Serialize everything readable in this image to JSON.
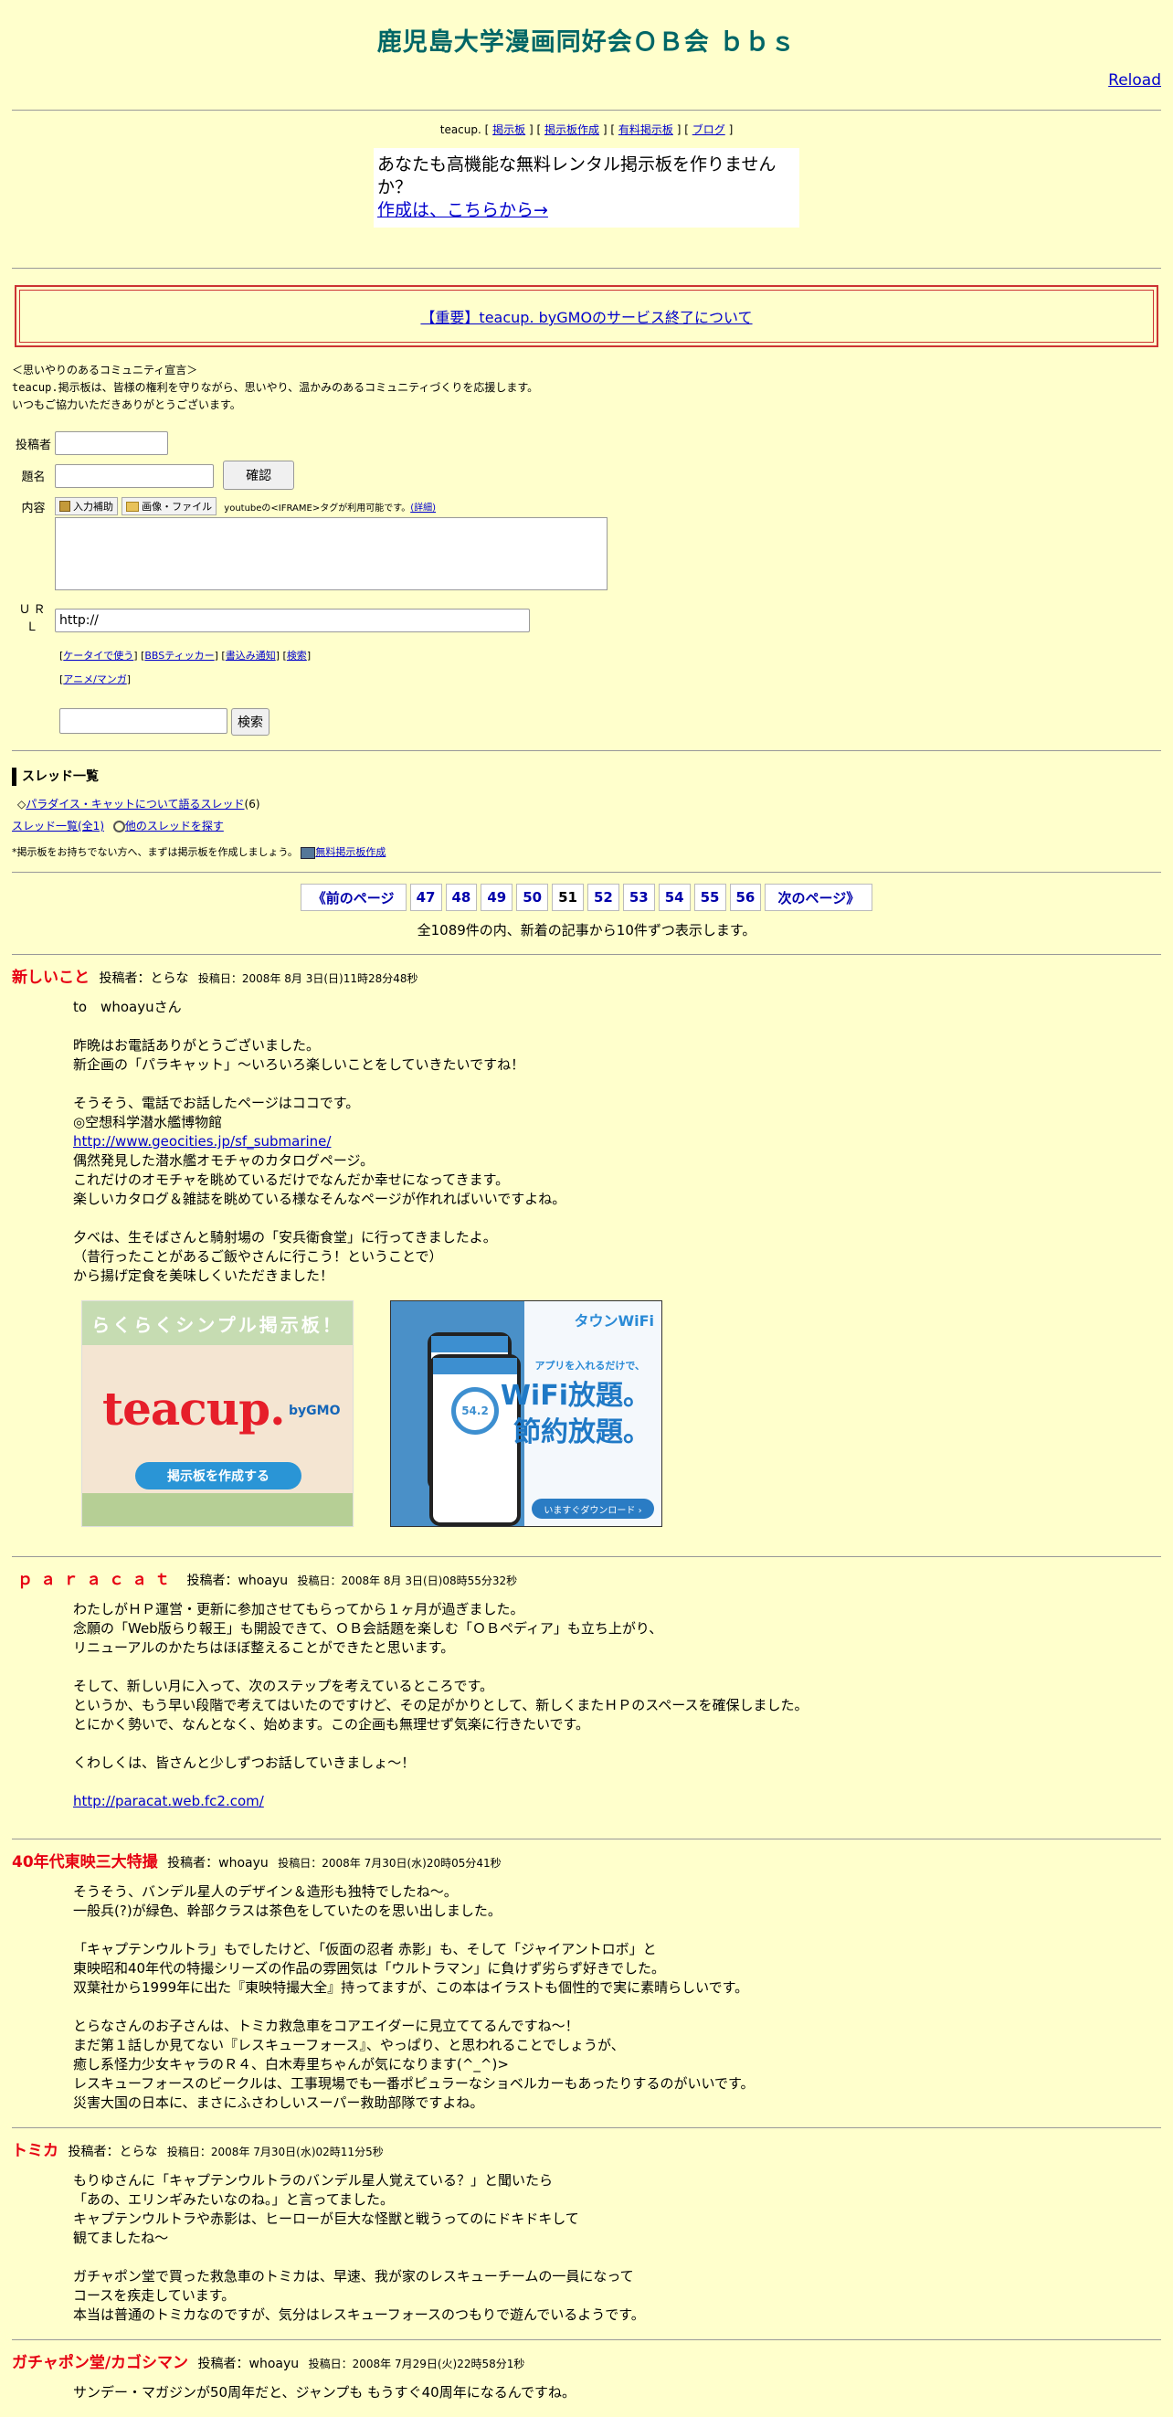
{
  "site_title": "鹿児島大学漫画同好会ＯＢ会 ｂｂｓ",
  "reload_label": "Reload",
  "infobar": {
    "prefix": "teacup. [",
    "items": [
      "掲示板",
      "掲示板作成",
      "有料掲示板",
      "ブログ"
    ],
    "sep": "] [",
    "suffix": "]"
  },
  "ad": {
    "line1": "あなたも高機能な無料レンタル掲示板を作りませんか？",
    "link": "作成は、こちらから→"
  },
  "notice_link": "【重要】teacup. byGMOのサービス終了について",
  "declaration": {
    "line1": "＜思いやりのあるコミュニティ宣言＞",
    "line2_mono": "teacup.",
    "line2_rest": "掲示板は、皆様の権利を守りながら、思いやり、温かみのあるコミュニティづくりを応援します。",
    "line3": "いつもご協力いただきありがとうございます。"
  },
  "form": {
    "author_label": "投稿者",
    "subject_label": "題名",
    "confirm_button": "確認",
    "content_label": "内容",
    "tool_input_help": "入力補助",
    "tool_image_file": "画像・ファイル",
    "iframe_note": "youtubeの<IFRAME>タグが利用可能です。",
    "iframe_detail": "(詳細)",
    "url_label": "ＵＲＬ",
    "url_value": "http://"
  },
  "links1": [
    "ケータイで使う",
    "BBSティッカー",
    "書込み通知",
    "検索"
  ],
  "links2": [
    "アニメ/マンガ"
  ],
  "search_button": "検索",
  "threads": {
    "heading": "スレッド一覧",
    "item_prefix": "◇",
    "item_link": "パラダイス・キャットについて語るスレッド",
    "item_count": "(6)",
    "all_link": "スレッド一覧(全1)",
    "other_link": "他のスレッドを探す"
  },
  "hint": {
    "text": "*掲示板をお持ちでない方へ、まずは掲示板を作成しましょう。",
    "link": "無料掲示板作成"
  },
  "pager": {
    "prev": "《前のページ",
    "pages": [
      "47",
      "48",
      "49",
      "50",
      "51",
      "52",
      "53",
      "54",
      "55",
      "56"
    ],
    "current": "51",
    "next": "次のページ》",
    "summary": "全1089件の内、新着の記事から10件ずつ表示します。"
  },
  "posts": [
    {
      "title": "新しいこと",
      "author": "投稿者：とらな",
      "date": "投稿日：2008年 8月 3日(日)11時28分48秒",
      "lines": [
        "to　whoayuさん",
        "",
        "昨晩はお電話ありがとうございました。",
        "新企画の「パラキャット」～いろいろ楽しいことをしていきたいですね！",
        "",
        "そうそう、電話でお話したページはココです。",
        "◎空想科学潜水艦博物館",
        "http://www.geocities.jp/sf_submarine/",
        "偶然発見した潜水艦オモチャのカタログページ。",
        "これだけのオモチャを眺めているだけでなんだか幸せになってきます。",
        "楽しいカタログ＆雑誌を眺めている様なそんなページが作れればいいですよね。",
        "",
        "夕べは、生そばさんと騎射場の「安兵衛食堂」に行ってきましたよ。",
        "（昔行ったことがあるご飯やさんに行こう！ということで）",
        "から揚げ定食を美味しくいただきました！"
      ],
      "banner_teacup": {
        "head": "らくらくシンプル掲示板！",
        "logo": "teacup.",
        "by": "byGMO",
        "button": "掲示板を作成する"
      },
      "banner_wifi": {
        "logo": "タウンWiFi",
        "sub": "アプリを入れるだけで、",
        "big1": "WiFi放題。",
        "big2": "節約放題。",
        "download": "いますぐダウンロード ›",
        "meter": "54.2"
      }
    },
    {
      "title": "ｐａｒａｃａｔ",
      "author": "投稿者：whoayu",
      "date": "投稿日：2008年 8月 3日(日)08時55分32秒",
      "lines": [
        "わたしがＨＰ運営・更新に参加させてもらってから１ヶ月が過ぎました。",
        "念願の「Web版らり報王」も開設できて、ＯＢ会話題を楽しむ「ＯＢペディア」も立ち上がり、",
        "リニューアルのかたちはほぼ整えることができたと思います。",
        "",
        "そして、新しい月に入って、次のステップを考えているところです。",
        "というか、もう早い段階で考えてはいたのですけど、その足がかりとして、新しくまたＨＰのスペースを確保しました。",
        "とにかく勢いで、なんとなく、始めます。この企画も無理せず気楽に行きたいです。",
        "",
        "くわしくは、皆さんと少しずつお話していきましょ～！",
        "",
        "http://paracat.web.fc2.com/"
      ]
    },
    {
      "title": "40年代東映三大特撮",
      "author": "投稿者：whoayu",
      "date": "投稿日：2008年 7月30日(水)20時05分41秒",
      "lines": [
        "そうそう、バンデル星人のデザイン＆造形も独特でしたね～。",
        "一般兵(?)が緑色、幹部クラスは茶色をしていたのを思い出しました。",
        "",
        "「キャプテンウルトラ」もでしたけど、「仮面の忍者 赤影」も、そして「ジャイアントロボ」と",
        "東映昭和40年代の特撮シリーズの作品の雰囲気は「ウルトラマン」に負けず劣らず好きでした。",
        "双葉社から1999年に出た『東映特撮大全』持ってますが、この本はイラストも個性的で実に素晴らしいです。",
        "",
        "とらなさんのお子さんは、トミカ救急車をコアエイダーに見立ててるんですね～！",
        "まだ第１話しか見てない『レスキューフォース』、やっぱり、と思われることでしょうが、",
        "癒し系怪力少女キャラのＲ４、白木寿里ちゃんが気になります(^_^)>",
        "レスキューフォースのビークルは、工事現場でも一番ポピュラーなショベルカーもあったりするのがいいです。",
        "災害大国の日本に、まさにふさわしいスーパー救助部隊ですよね。"
      ]
    },
    {
      "title": "トミカ",
      "author": "投稿者：とらな",
      "date": "投稿日：2008年 7月30日(水)02時11分5秒",
      "lines": [
        "もりゆさんに「キャプテンウルトラのバンデル星人覚えている？」と聞いたら",
        "「あの、エリンギみたいなのね。」と言ってました。",
        "キャプテンウルトラや赤影は、ヒーローが巨大な怪獣と戦うってのにドキドキして",
        "観てましたね～",
        "",
        "ガチャポン堂で買った救急車のトミカは、早速、我が家のレスキューチームの一員になって",
        "コースを疾走しています。",
        "本当は普通のトミカなのですが、気分はレスキューフォースのつもりで遊んでいるようです。"
      ]
    },
    {
      "title": "ガチャポン堂/カゴシマン",
      "author": "投稿者：whoayu",
      "date": "投稿日：2008年 7月29日(火)22時58分1秒",
      "lines": [
        "サンデー・マガジンが50周年だと、ジャンプも もうすぐ40周年になるんですね。"
      ]
    }
  ]
}
